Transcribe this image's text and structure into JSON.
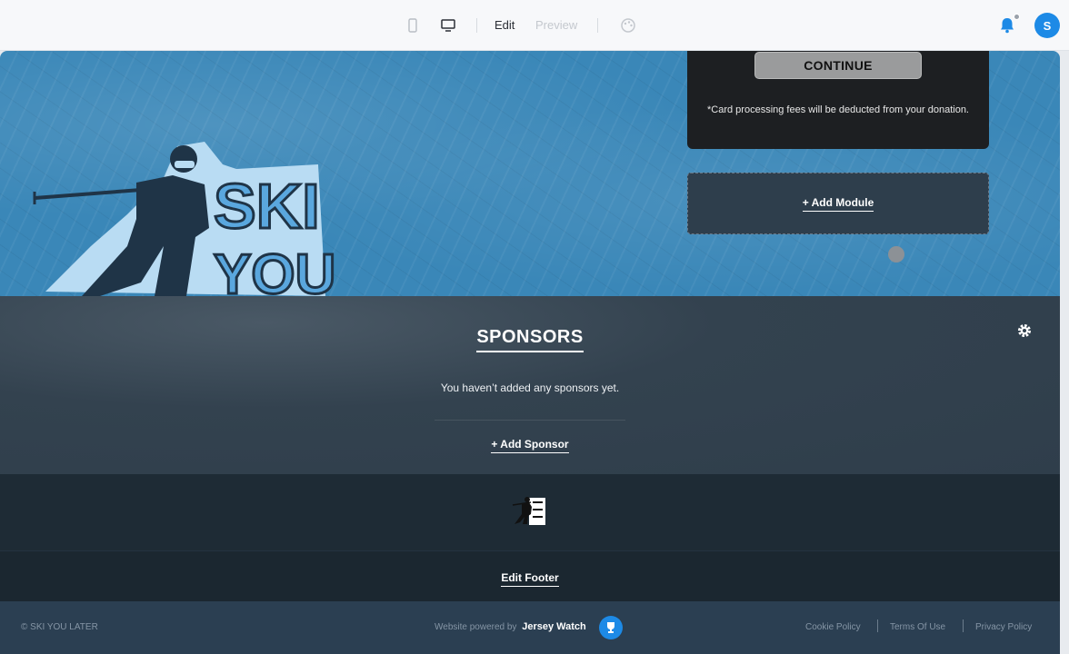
{
  "toolbar": {
    "edit_label": "Edit",
    "preview_label": "Preview",
    "avatar_initial": "S",
    "icons": [
      "mobile-icon",
      "desktop-icon",
      "palette-icon",
      "bell-icon"
    ]
  },
  "hero": {
    "logo_text_line1": "SKI",
    "logo_text_line2": "YOU"
  },
  "donation_card": {
    "continue_label": "CONTINUE",
    "fee_note": "*Card processing fees will be deducted from your donation."
  },
  "module": {
    "add_label": "+ Add Module"
  },
  "sponsors": {
    "title": "SPONSORS",
    "empty_message": "You haven’t added any sponsors yet.",
    "add_label": "+ Add Sponsor"
  },
  "footer": {
    "edit_label": "Edit Footer",
    "copyright": "© SKI YOU LATER",
    "powered_prefix": "Website powered by",
    "powered_brand": "Jersey Watch",
    "links": [
      "Cookie Policy",
      "Terms Of Use",
      "Privacy Policy"
    ]
  },
  "colors": {
    "accent": "#1d8ae6",
    "hero_blue": "#3a87b8",
    "sponsor_bg": "#33424f",
    "footer_bg": "#1e2b35",
    "bottom_bar": "#2b3f52"
  }
}
